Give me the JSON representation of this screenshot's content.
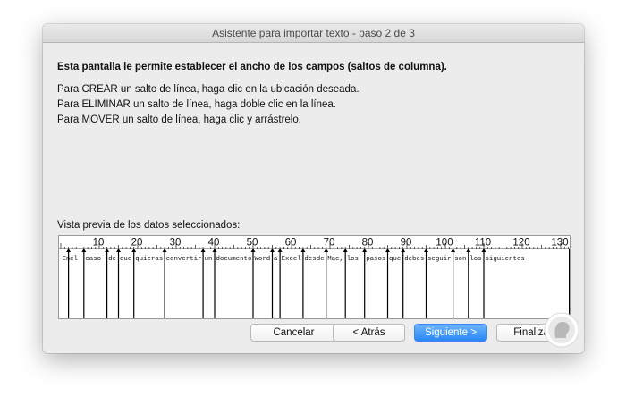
{
  "window": {
    "title": "Asistente para importar texto - paso 2 de 3"
  },
  "content": {
    "heading": "Esta pantalla le permite establecer el ancho de los campos (saltos de columna).",
    "instructions": [
      "Para CREAR un salto de línea, haga clic en la ubicación deseada.",
      "Para ELIMINAR un salto de línea, haga doble clic en la línea.",
      "Para MOVER un salto de línea, haga clic y arrástrelo."
    ],
    "preview_label": "Vista previa de los datos seleccionados:"
  },
  "ruler": {
    "labels": [
      "10",
      "20",
      "30",
      "40",
      "50",
      "60",
      "70",
      "80",
      "90",
      "100",
      "110",
      "120",
      "130"
    ]
  },
  "preview_row": [
    "En",
    "el",
    "caso",
    "de",
    "que",
    "quieras",
    "convertir",
    "un",
    "documento",
    "Word",
    "a",
    "Excel",
    "desde",
    "Mac,",
    "los",
    "pasos",
    "que",
    "debes",
    "seguir",
    "son",
    "los",
    "siguientes"
  ],
  "column_breaks": [
    2,
    6,
    12,
    15,
    19,
    27,
    37,
    40,
    50,
    55,
    57,
    63,
    69,
    74,
    79,
    85,
    89,
    95,
    102,
    106,
    110
  ],
  "buttons": {
    "cancel": "Cancelar",
    "back": "< Atrás",
    "next": "Siguiente >",
    "finish": "Finalizar"
  },
  "colors": {
    "accent": "#2a87f6",
    "window_bg": "#ececec"
  },
  "icons": {
    "badge": "person-head-icon"
  }
}
